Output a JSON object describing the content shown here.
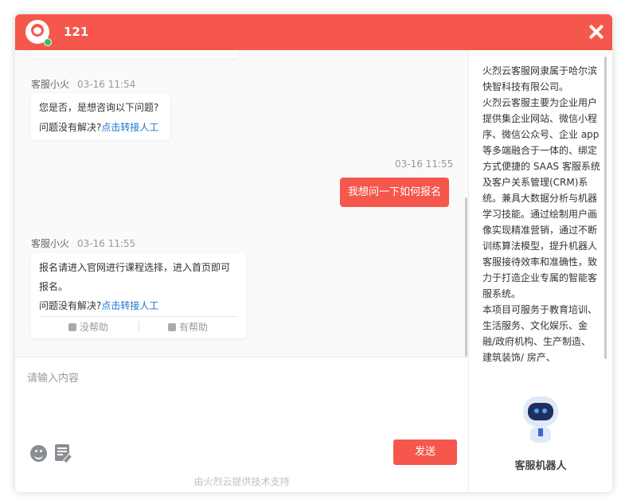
{
  "window": {
    "title": "121"
  },
  "chat": {
    "messages": [
      {
        "sender": "客服小火",
        "time": "03-16 11:54",
        "lines": [
          "您是否，是想咨询以下问题?"
        ],
        "unresolved_prompt": "问题没有解决?",
        "transfer_link": "点击转接人工"
      },
      {
        "sender": "me",
        "time": "03-16 11:55",
        "text": "我想问一下如何报名"
      },
      {
        "sender": "客服小火",
        "time": "03-16 11:55",
        "lines": [
          "报名请进入官网进行课程选择，进入首页即可",
          "报名。"
        ],
        "unresolved_prompt": "问题没有解决?",
        "transfer_link": "点击转接人工",
        "feedback": {
          "unhelpful": "没帮助",
          "helpful": "有帮助"
        }
      }
    ]
  },
  "input": {
    "placeholder": "请输入内容",
    "send_label": "发送"
  },
  "footer": {
    "text": "由火烈云提供技术支持"
  },
  "sidebar": {
    "paragraphs": [
      "火烈云客服网隶属于哈尔滨快智科技有限公司。",
      "火烈云客服主要为企业用户提供集企业网站、微信小程序、微信公众号、企业 app 等多端融合于一体的、绑定方式便捷的 SAAS 客服系统及客户关系管理(CRM)系统。兼具大数据分析与机器学习技能。通过绘制用户画像实现精准营销，通过不断训练算法模型，提升机器人客服接待效率和准确性，致力于打造企业专属的智能客服系统。",
      "本项目可服务于教育培训、生活服务、文化娱乐、金融/政府机构、生产制造、建筑装饰/ 房产、"
    ],
    "robot_label": "客服机器人"
  },
  "colors": {
    "accent": "#f5574c",
    "link": "#1a74d1",
    "online": "#2fc25b"
  },
  "icons": [
    "avatar-logo",
    "close-icon",
    "thumbs-down-icon",
    "thumbs-up-icon",
    "emoji-icon",
    "note-icon",
    "robot-mascot"
  ]
}
